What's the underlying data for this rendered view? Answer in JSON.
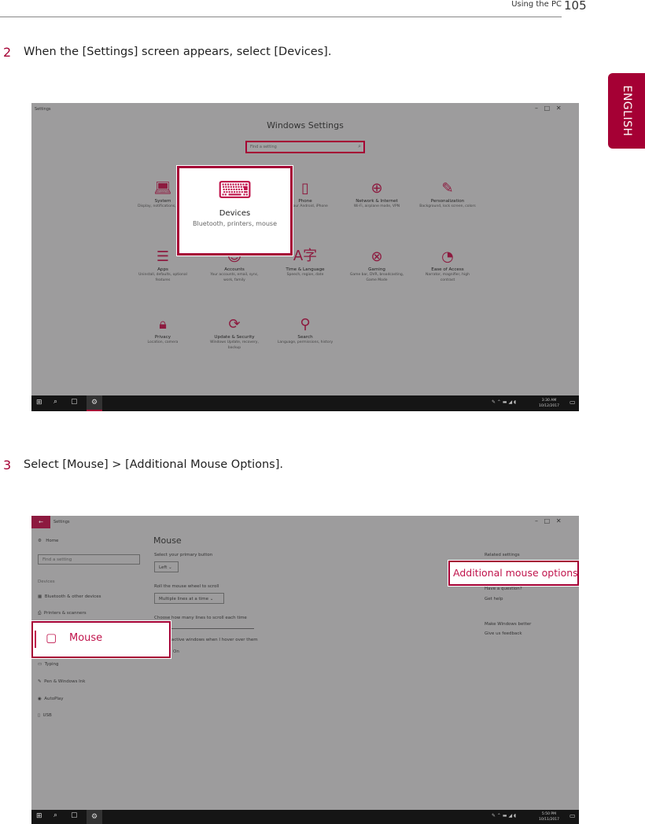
{
  "header": {
    "section": "Using the PC",
    "page_number": "105"
  },
  "language_tab": "ENGLISH",
  "steps": [
    {
      "number": "2",
      "text": "When the [Settings] screen appears, select [Devices]."
    },
    {
      "number": "3",
      "text": "Select [Mouse] > [Additional Mouse Options]."
    }
  ],
  "screenshot1": {
    "window_title": "Settings",
    "heading": "Windows Settings",
    "search_placeholder": "Find a setting",
    "tiles": [
      {
        "title": "System",
        "desc": "Display, notifications, power",
        "icon": "laptop-icon"
      },
      {
        "title": "Devices",
        "desc": "Bluetooth, printers, mouse",
        "icon": "devices-icon"
      },
      {
        "title": "Phone",
        "desc": "Link your Android, iPhone",
        "icon": "phone-icon"
      },
      {
        "title": "Network & Internet",
        "desc": "Wi-Fi, airplane mode, VPN",
        "icon": "globe-icon"
      },
      {
        "title": "Personalization",
        "desc": "Background, lock screen, colors",
        "icon": "paintbrush-icon"
      },
      {
        "title": "Apps",
        "desc": "Uninstall, defaults, optional features",
        "icon": "apps-list-icon"
      },
      {
        "title": "Accounts",
        "desc": "Your accounts, email, sync, work, family",
        "icon": "person-icon"
      },
      {
        "title": "Time & Language",
        "desc": "Speech, region, date",
        "icon": "time-language-icon"
      },
      {
        "title": "Gaming",
        "desc": "Game bar, DVR, broadcasting, Game Mode",
        "icon": "xbox-icon"
      },
      {
        "title": "Ease of Access",
        "desc": "Narrator, magnifier, high contrast",
        "icon": "ease-of-access-icon"
      },
      {
        "title": "Privacy",
        "desc": "Location, camera",
        "icon": "lock-icon"
      },
      {
        "title": "Update & Security",
        "desc": "Windows Update, recovery, backup",
        "icon": "sync-icon"
      },
      {
        "title": "Search",
        "desc": "Language, permissions, history",
        "icon": "search-icon"
      }
    ],
    "clock": {
      "time": "3:30 AM",
      "date": "10/12/2017"
    }
  },
  "screenshot2": {
    "window_title": "Settings",
    "sidebar": {
      "home": "Home",
      "search_placeholder": "Find a setting",
      "group": "Devices",
      "items": [
        "Bluetooth & other devices",
        "Printers & scanners",
        "Mouse",
        "Typing",
        "Pen & Windows Ink",
        "AutoPlay",
        "USB"
      ]
    },
    "main": {
      "title": "Mouse",
      "primary_label": "Select your primary button",
      "primary_value": "Left",
      "wheel_label": "Roll the mouse wheel to scroll",
      "wheel_value": "Multiple lines at a time",
      "lines_label": "Choose how many lines to scroll each time",
      "inactive_label": "Scroll inactive windows when I hover over them",
      "inactive_value": "On"
    },
    "related": {
      "heading": "Related settings",
      "link": "Additional mouse options",
      "question": "Have a question?",
      "help": "Get help",
      "better": "Make Windows better",
      "feedback": "Give us feedback"
    },
    "clock": {
      "time": "5:50 PM",
      "date": "10/11/2017"
    }
  },
  "colors": {
    "accent": "#a50034"
  }
}
